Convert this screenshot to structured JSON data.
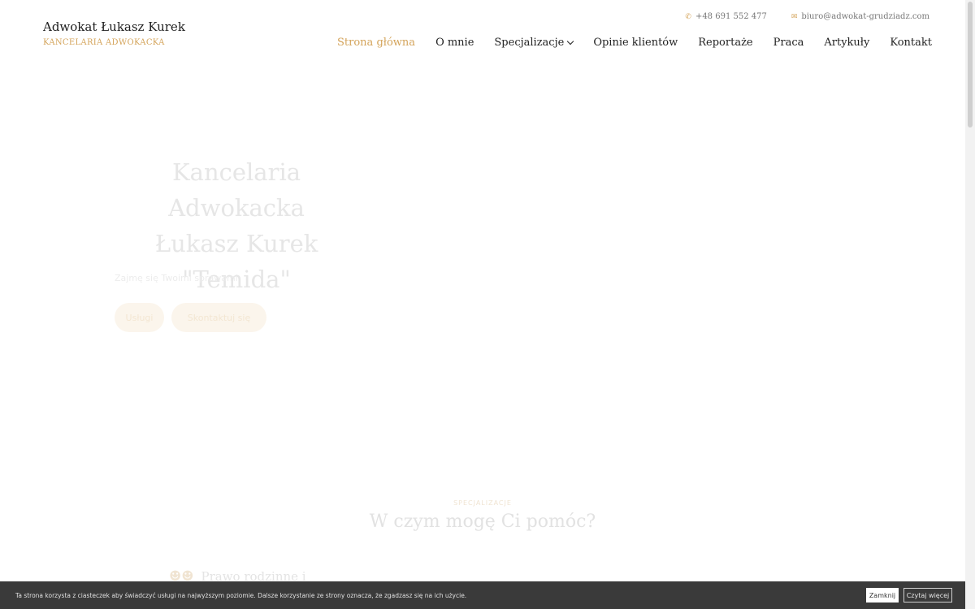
{
  "header": {
    "brand_name": "Adwokat Łukasz Kurek",
    "brand_tagline": "KANCELARIA ADWOKACKA",
    "phone": "+48 691 552 477",
    "email": "biuro@adwokat-grudziadz.com"
  },
  "nav": {
    "items": [
      {
        "label": "Strona główna",
        "active": true
      },
      {
        "label": "O mnie"
      },
      {
        "label": "Specjalizacje",
        "has_dropdown": true
      },
      {
        "label": "Opinie klientów"
      },
      {
        "label": "Reportaże"
      },
      {
        "label": "Praca"
      },
      {
        "label": "Artykuły"
      },
      {
        "label": "Kontakt"
      }
    ]
  },
  "hero": {
    "title_line1": "Kancelaria Adwokacka",
    "title_line2": "Łukasz Kurek",
    "title_line3": "\"Temida\"",
    "subtitle": "Zajmę się Twoimi sprawami",
    "btn_primary": "Usługi",
    "btn_secondary": "Skontaktuj się"
  },
  "section": {
    "kicker": "SPECJALIZACJE",
    "title": "W czym mogę Ci pomóc?",
    "first_item": "Prawo rodzinne i"
  },
  "cookie": {
    "text": "Ta strona korzysta z ciasteczek aby świadczyć usługi na najwyższym poziomie. Dalsze korzystanie ze strony oznacza, że zgadzasz się na ich użycie.",
    "close_label": "Zamknij",
    "more_label": "Czytaj więcej"
  },
  "colors": {
    "accent": "#d4a45b",
    "cookie_bg": "#3a3a3a"
  },
  "icons": {
    "phone": "phone-icon",
    "email": "envelope-icon",
    "chevron": "chevron-down-icon",
    "family": "family-icon"
  }
}
